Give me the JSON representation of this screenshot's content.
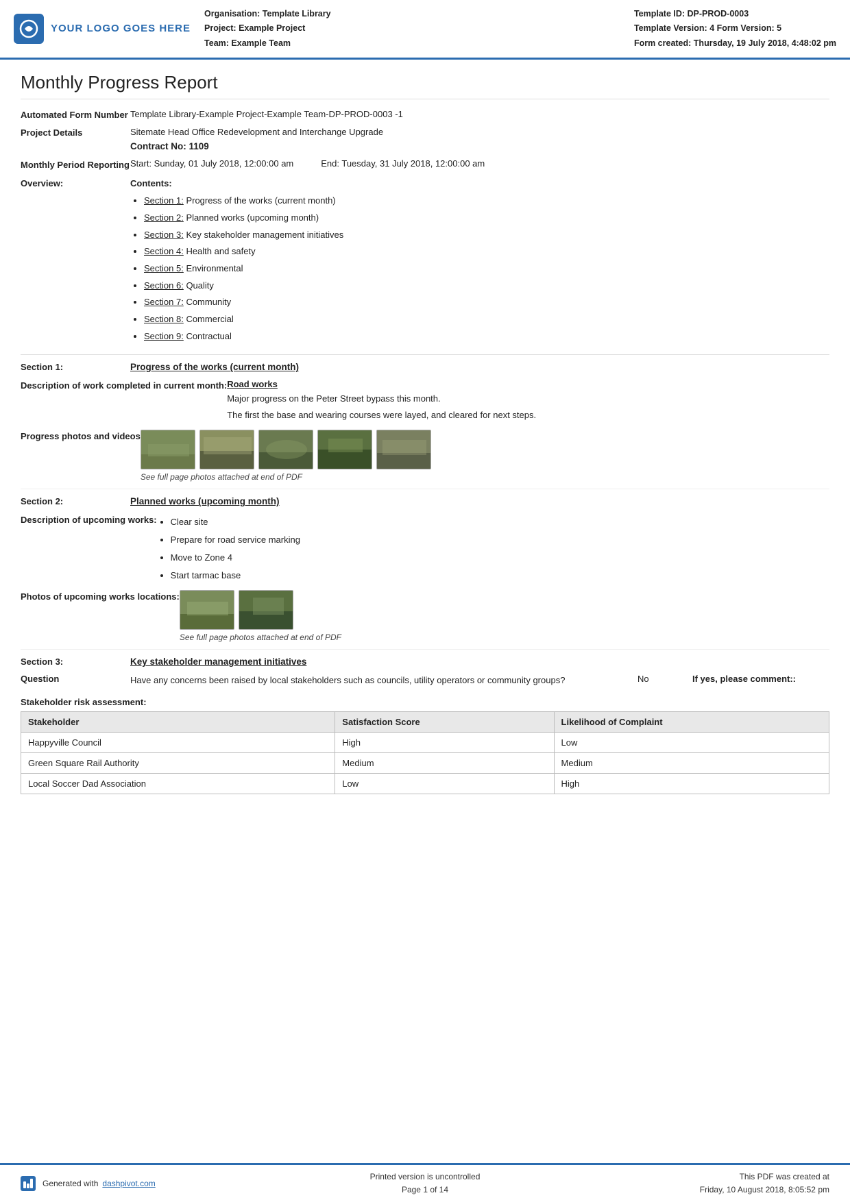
{
  "header": {
    "logo_text": "YOUR LOGO GOES HERE",
    "org_label": "Organisation:",
    "org_value": "Template Library",
    "project_label": "Project:",
    "project_value": "Example Project",
    "team_label": "Team:",
    "team_value": "Example Team",
    "template_id_label": "Template ID:",
    "template_id_value": "DP-PROD-0003",
    "template_version_label": "Template Version:",
    "template_version_value": "4",
    "form_version_label": "Form Version:",
    "form_version_value": "5",
    "form_created_label": "Form created:",
    "form_created_value": "Thursday, 19 July 2018, 4:48:02 pm"
  },
  "report": {
    "title": "Monthly Progress Report",
    "form_number_label": "Automated Form Number",
    "form_number_value": "Template Library-Example Project-Example Team-DP-PROD-0003   -1",
    "project_details_label": "Project Details",
    "project_details_value": "Sitemate Head Office Redevelopment and Interchange Upgrade",
    "contract_no": "Contract No: 1109",
    "period_label": "Monthly Period Reporting",
    "period_start": "Start: Sunday, 01 July 2018, 12:00:00 am",
    "period_end": "End: Tuesday, 31 July 2018, 12:00:00 am",
    "overview_label": "Overview:",
    "overview_contents_title": "Contents:",
    "toc": [
      {
        "link": "Section 1:",
        "text": " Progress of the works (current month)"
      },
      {
        "link": "Section 2:",
        "text": " Planned works (upcoming month)"
      },
      {
        "link": "Section 3:",
        "text": " Key stakeholder management initiatives"
      },
      {
        "link": "Section 4:",
        "text": " Health and safety"
      },
      {
        "link": "Section 5:",
        "text": " Environmental"
      },
      {
        "link": "Section 6:",
        "text": " Quality"
      },
      {
        "link": "Section 7:",
        "text": " Community"
      },
      {
        "link": "Section 8:",
        "text": " Commercial"
      },
      {
        "link": "Section 9:",
        "text": " Contractual"
      }
    ],
    "section1_label": "Section 1:",
    "section1_title": "Progress of the works (current month)",
    "desc_work_label": "Description of work completed in current month:",
    "work_title": "Road works",
    "work_desc1": "Major progress on the Peter Street bypass this month.",
    "work_desc2": "The first the base and wearing courses were layed, and cleared for next steps.",
    "photos_label": "Progress photos and videos",
    "photos_note": "See full page photos attached at end of PDF",
    "section2_label": "Section 2:",
    "section2_title": "Planned works (upcoming month)",
    "upcoming_label": "Description of upcoming works:",
    "upcoming_items": [
      "Clear site",
      "Prepare for road service marking",
      "Move to Zone 4",
      "Start tarmac base"
    ],
    "upcoming_photos_label": "Photos of upcoming works locations:",
    "upcoming_photos_note": "See full page photos attached at end of PDF",
    "section3_label": "Section 3:",
    "section3_title": "Key stakeholder management initiatives",
    "question_label": "Question",
    "question_text": "Have any concerns been raised by local stakeholders such as councils, utility operators or community groups?",
    "question_answer": "No",
    "question_comment": "If yes, please comment::",
    "stakeholder_title": "Stakeholder risk assessment:",
    "stake_headers": [
      "Stakeholder",
      "Satisfaction Score",
      "Likelihood of Complaint"
    ],
    "stake_rows": [
      [
        "Happyville Council",
        "High",
        "Low"
      ],
      [
        "Green Square Rail Authority",
        "Medium",
        "Medium"
      ],
      [
        "Local Soccer Dad Association",
        "Low",
        "High"
      ]
    ],
    "footer_generated": "Generated with ",
    "footer_link_text": "dashpivot.com",
    "footer_print_note": "Printed version is uncontrolled",
    "footer_page": "Page 1 of 14",
    "footer_created": "This PDF was created at",
    "footer_created_date": "Friday, 10 August 2018, 8:05:52 pm"
  }
}
